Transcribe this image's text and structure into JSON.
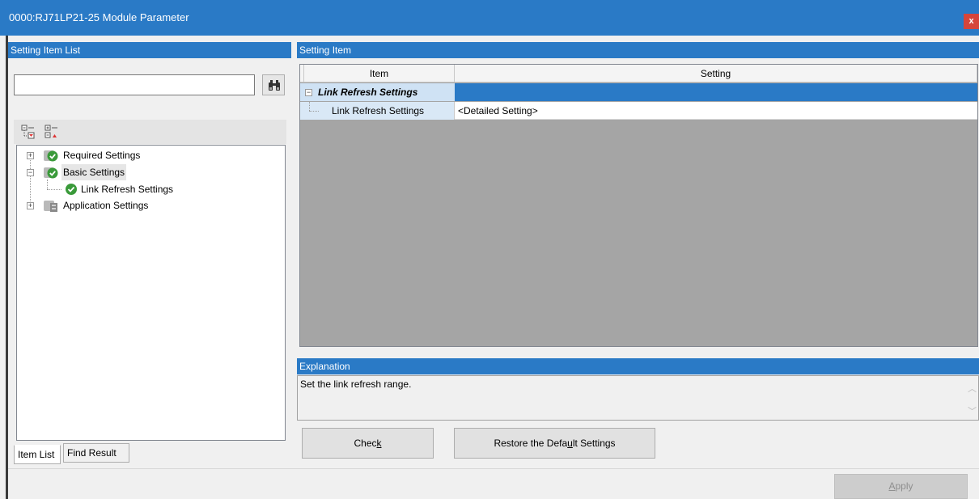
{
  "window": {
    "title": "0000:RJ71LP21-25 Module Parameter",
    "close_label": "x"
  },
  "left_panel": {
    "header": "Setting Item List",
    "search": {
      "value": "",
      "button_icon": "binoculars-icon"
    },
    "toolbar": [
      {
        "icon": "expand-all-icon"
      },
      {
        "icon": "collapse-all-icon"
      }
    ],
    "tree": [
      {
        "label": "Required Settings",
        "icon": "check-folder-icon",
        "expander": "+",
        "level": 0
      },
      {
        "label": "Basic Settings",
        "icon": "check-folder-icon",
        "expander": "−",
        "level": 0,
        "selected": true
      },
      {
        "label": "Link Refresh Settings",
        "icon": "check-circle-icon",
        "level": 1
      },
      {
        "label": "Application Settings",
        "icon": "folder-gear-icon",
        "expander": "+",
        "level": 0
      }
    ],
    "tabs": [
      "Item List",
      "Find Result"
    ]
  },
  "right_panel": {
    "header": "Setting Item",
    "grid": {
      "columns": [
        "Item",
        "Setting"
      ],
      "group": {
        "label": "Link Refresh Settings",
        "expander": "−"
      },
      "rows": [
        {
          "item": "Link Refresh Settings",
          "setting": "<Detailed Setting>"
        }
      ]
    },
    "explanation": {
      "header": "Explanation",
      "text": "Set the link refresh range."
    },
    "buttons": {
      "check": {
        "pre": "Chec",
        "mnemonic": "k",
        "post": ""
      },
      "restore": {
        "pre": "Restore the Defa",
        "mnemonic": "u",
        "post": "lt Settings"
      }
    }
  },
  "footer": {
    "apply": {
      "pre": "",
      "mnemonic": "A",
      "post": "pply"
    }
  },
  "colors": {
    "accent": "#2a7ac6",
    "selected_row": "#2a7ac6",
    "grid_bg": "#a5a5a5",
    "check_green": "#3a9a3a",
    "close": "#d6453a"
  }
}
